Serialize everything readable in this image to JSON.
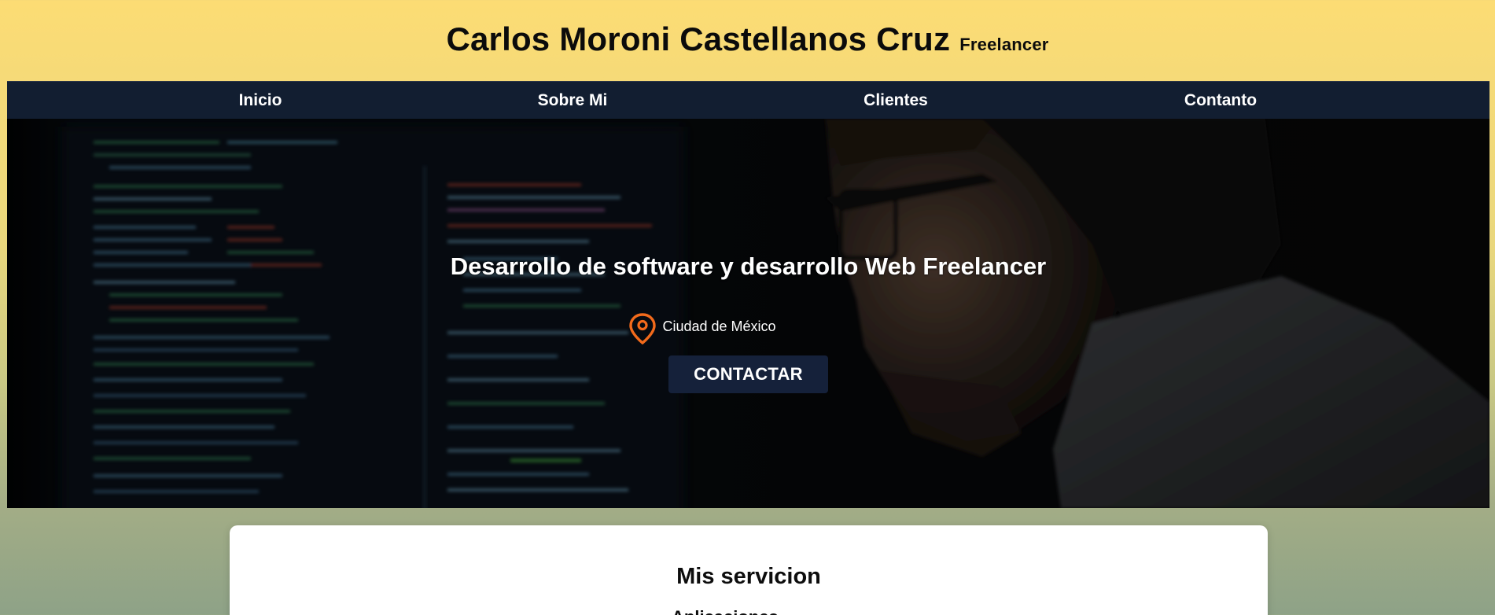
{
  "header": {
    "name": "Carlos Moroni Castellanos Cruz",
    "tag": "Freelancer"
  },
  "nav": {
    "items": [
      "Inicio",
      "Sobre Mi",
      "Clientes",
      "Contanto"
    ]
  },
  "hero": {
    "title": "Desarrollo de software y desarrollo Web Freelancer",
    "location_icon": "map-pin-icon",
    "location": "Ciudad de México",
    "cta_label": "CONTACTAR"
  },
  "services": {
    "title": "Mis servicion",
    "first_item": "Aplicaciones"
  },
  "colors": {
    "nav_bg": "#121e31",
    "button_bg": "#15213a",
    "pin_color": "#f26a1b",
    "header_bg_top": "#fcdc74",
    "header_bg_bottom": "#8ea287"
  }
}
